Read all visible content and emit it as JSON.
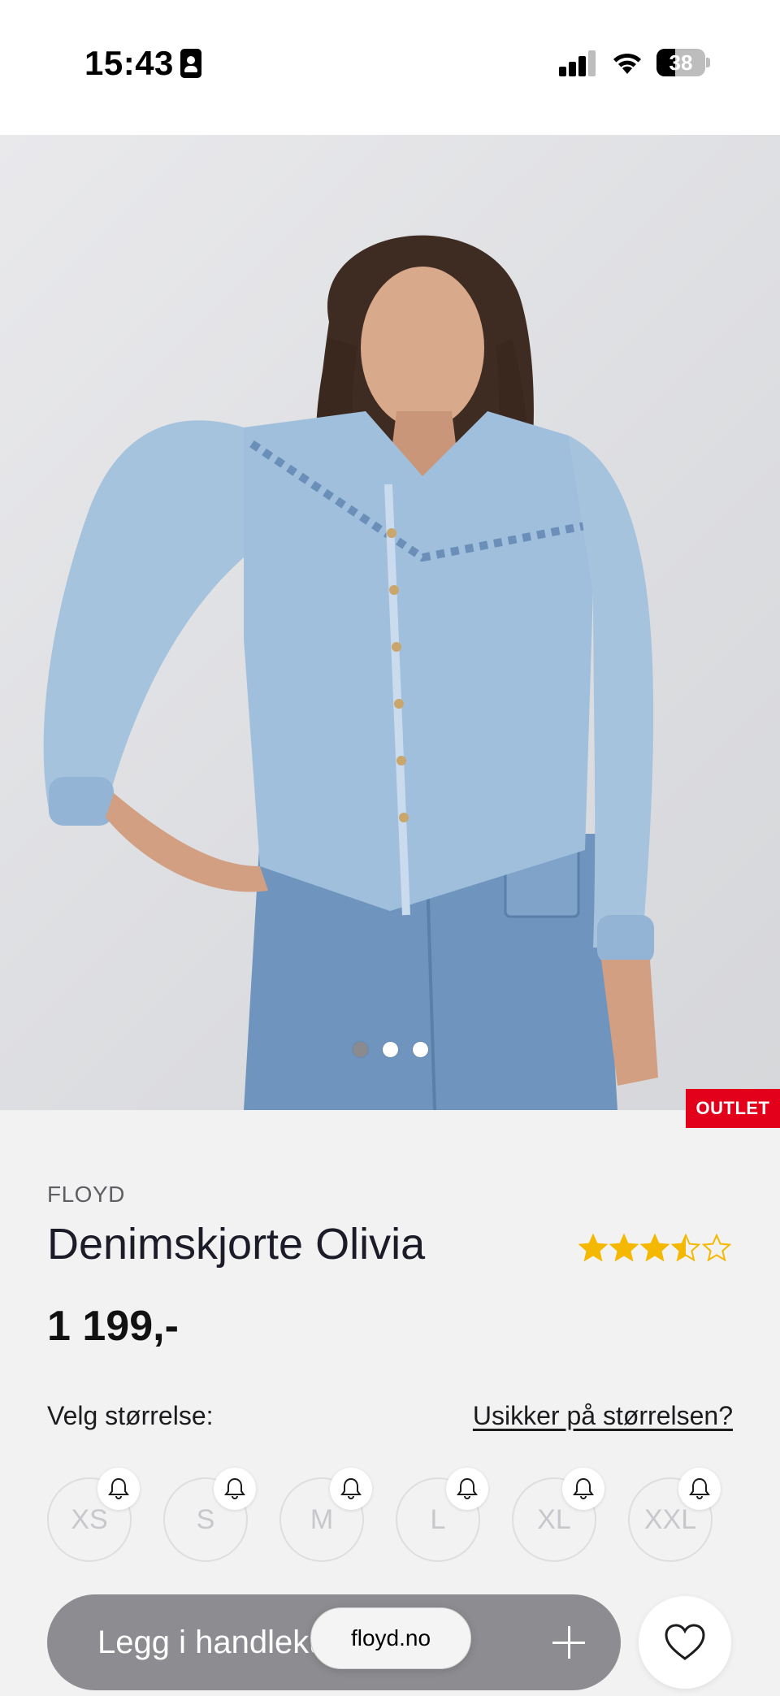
{
  "status_bar": {
    "time": "15:43",
    "battery_level": "38",
    "battery_fraction": 0.38
  },
  "product_image": {
    "alt": "Model wearing light blue denim shirt",
    "carousel_count": 3,
    "carousel_active_index": 0
  },
  "badge": {
    "label": "OUTLET",
    "color": "#e2001a"
  },
  "product": {
    "brand": "FLOYD",
    "title": "Denimskjorte Olivia",
    "price": "1 199,-",
    "rating": 3.5,
    "rating_max": 5,
    "rating_color": "#f5b800"
  },
  "size_selector": {
    "label": "Velg størrelse:",
    "help_link": "Usikker på størrelsen?",
    "sizes": [
      "XS",
      "S",
      "M",
      "L",
      "XL",
      "XXL"
    ]
  },
  "actions": {
    "add_to_cart_label": "Legg i handlekurv",
    "plus_icon": "plus-icon",
    "wishlist_icon": "heart-icon"
  },
  "browser": {
    "url": "floyd.no"
  }
}
